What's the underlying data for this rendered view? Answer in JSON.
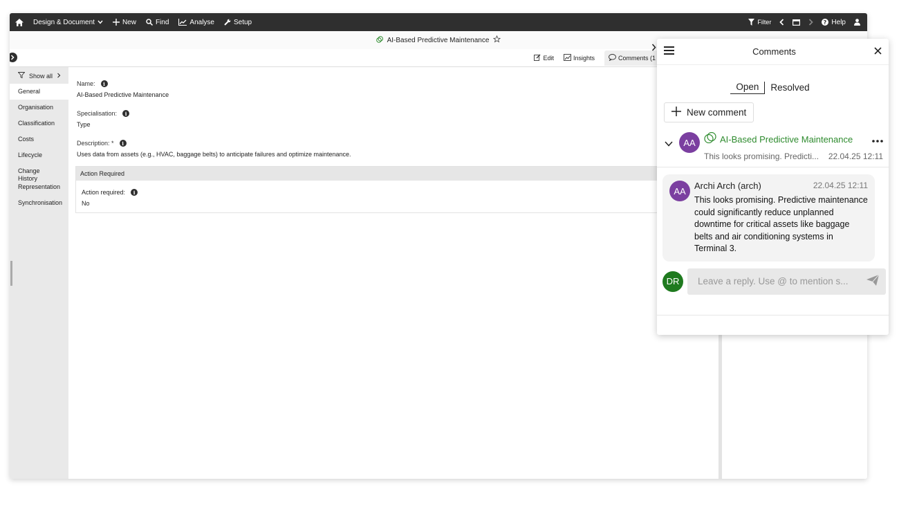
{
  "topbar": {
    "design_document": "Design & Document",
    "new": "New",
    "find": "Find",
    "analyse": "Analyse",
    "setup": "Setup",
    "filter": "Filter",
    "help": "Help"
  },
  "titlebar": {
    "title": "AI-Based Predictive Maintenance"
  },
  "toolbar": {
    "edit": "Edit",
    "insights": "Insights",
    "comments": "Comments (1"
  },
  "sidebar": {
    "show_all": "Show all",
    "items": [
      "General",
      "Organisation",
      "Classification",
      "Costs",
      "Lifecycle",
      "Change History",
      "Representation",
      "Synchronisation"
    ]
  },
  "main": {
    "name_label": "Name:",
    "name_value": "AI-Based Predictive Maintenance",
    "spec_label": "Specialisation:",
    "spec_value": "Type",
    "desc_label": "Description: *",
    "desc_value": "Uses data from assets (e.g., HVAC, baggage belts) to anticipate failures and optimize maintenance.",
    "section_title": "Action Required",
    "action_label": "Action required:",
    "action_value": "No"
  },
  "comments": {
    "title": "Comments",
    "tab_open": "Open",
    "tab_resolved": "Resolved",
    "new_comment": "New comment",
    "thread": {
      "avatar": "AA",
      "title": "AI-Based Predictive Maintenance",
      "preview": "This looks promising. Predicti...",
      "date": "22.04.25 12:11"
    },
    "message": {
      "avatar": "AA",
      "author": "Archi Arch (arch)",
      "date": "22.04.25 12:11",
      "text": "This looks promising. Predictive maintenance could significantly reduce unplanned downtime for critical assets like baggage belts and air conditioning systems in Terminal 3."
    },
    "reply": {
      "avatar": "DR",
      "placeholder": "Leave a reply. Use @ to mention s..."
    }
  },
  "colors": {
    "topbar": "#2f2f2f",
    "accent_green": "#2e8b2e",
    "avatar_purple": "#7b3fa0",
    "avatar_green": "#1f7a1f"
  }
}
